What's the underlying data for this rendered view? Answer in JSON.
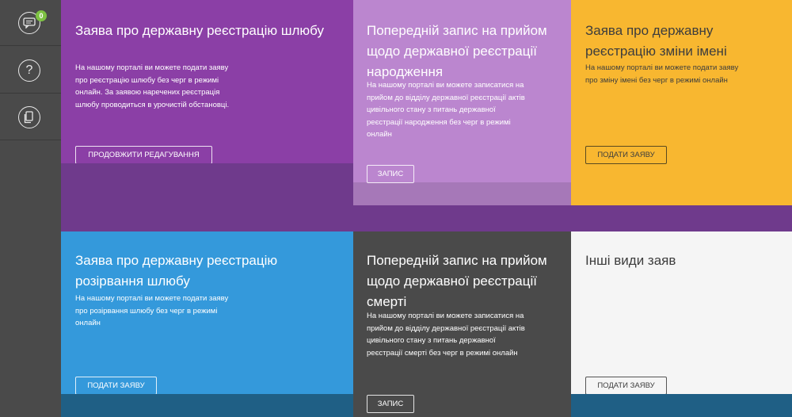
{
  "sidebar": {
    "badge_count": "0",
    "help_symbol": "?",
    "icons": [
      "chat-icon",
      "help-icon",
      "document-icon"
    ]
  },
  "tiles": [
    {
      "title": "Заява про державну реєстрацію шлюбу",
      "text": "На нашому порталі ви можете подати заяву про реєстрацію шлюбу без черг в режимі онлайн. За заявою наречених реєстрація шлюбу проводиться в урочистій обстановці.",
      "button": "ПРОДОВЖИТИ РЕДАГУВАННЯ",
      "color": "#8b3fa6"
    },
    {
      "title": "Попередній запис на прийом щодо державної реєстрації народження",
      "text": "На нашому порталі ви можете записатися на прийом до відділу державної реєстрації актів цивільного стану з питань державної реєстрації народження без черг в режимі онлайн",
      "button": "ЗАПИС",
      "color": "#bb86cf"
    },
    {
      "title": "Заява про державну реєстрацію зміни імені",
      "text": "На нашому порталі ви можете подати заяву про зміну імені без черг в режимі онлайн",
      "button": "ПОДАТИ ЗАЯВУ",
      "color": "#f8b730"
    },
    {
      "title": "Заява про державну реєстрацію розірвання шлюбу",
      "text": "На нашому порталі ви можете подати заяву про розірвання шлюбу без черг в режимі онлайн",
      "button": "ПОДАТИ ЗАЯВУ",
      "color": "#3499db"
    },
    {
      "title": "Попередній запис на прийом щодо державної реєстрації смерті",
      "text": "На нашому порталі ви можете записатися на прийом до відділу державної реєстрації актів цивільного стану з питань державної реєстрації смерті без черг в режимі онлайн",
      "button": "ЗАПИС",
      "color": "#4a4a4a"
    },
    {
      "title": "Інші види заяв",
      "text": "",
      "button": "ПОДАТИ ЗАЯВУ",
      "color": "#f5f5f5"
    }
  ],
  "colors": {
    "purple_band": "#6f3a8c",
    "blue_band": "#1f5f85",
    "sidebar": "#4a4a4a"
  }
}
